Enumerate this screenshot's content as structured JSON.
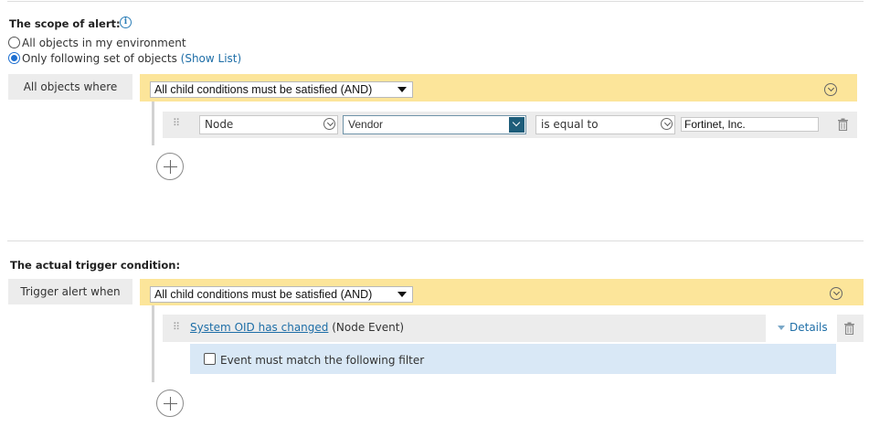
{
  "scope": {
    "title": "The scope of alert:",
    "info_icon": "info-icon",
    "options": [
      {
        "label": "All objects in my environment",
        "selected": false
      },
      {
        "label": "Only following set of objects",
        "selected": true
      }
    ],
    "show_list_link": "(Show List)",
    "side_label": "All objects where",
    "group_select": "All child conditions must be satisfied (AND)",
    "condition": {
      "object": "Node",
      "property": "Vendor",
      "operator": "is equal to",
      "value": "Fortinet, Inc."
    }
  },
  "trigger": {
    "title": "The actual trigger condition:",
    "side_label": "Trigger alert when",
    "group_select": "All child conditions must be satisfied (AND)",
    "event": {
      "link": "System OID has changed",
      "type": "(Node Event)",
      "details_label": "Details",
      "filter_label": "Event must match the following filter",
      "filter_checked": false
    }
  },
  "colors": {
    "accent_yellow": "#fce59a",
    "link_blue": "#1e6ea7",
    "dropdown_dark_blue": "#1e5d7a",
    "filter_row_blue": "#d9e8f6"
  },
  "icons": [
    "info-icon",
    "circle-chevron-down-icon",
    "grip-icon",
    "trash-icon",
    "plus-icon",
    "chevron-down-icon",
    "triangle-down-icon"
  ]
}
